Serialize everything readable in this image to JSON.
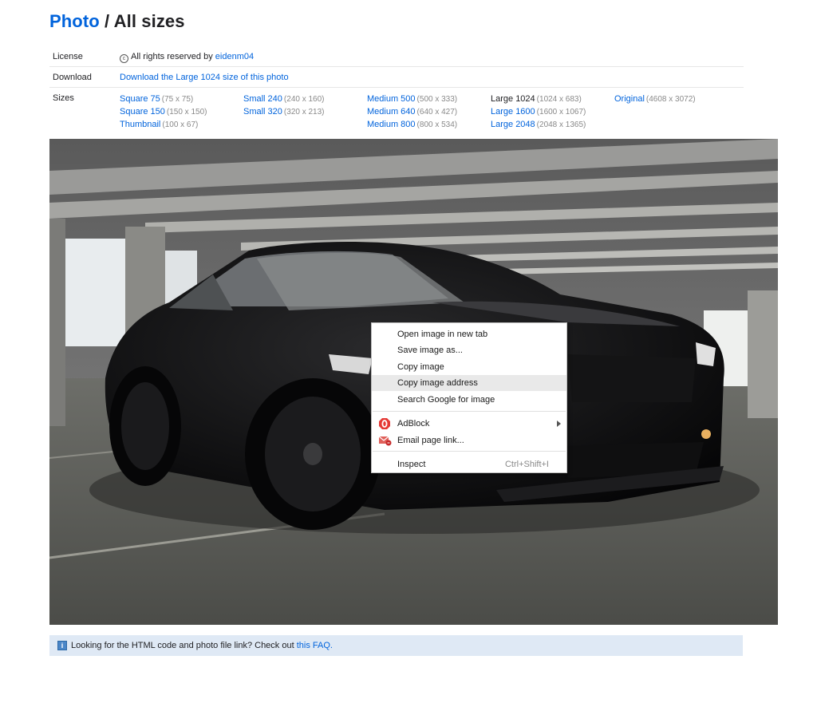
{
  "header": {
    "photo_link": "Photo",
    "separator": " / ",
    "title": "All sizes"
  },
  "meta": {
    "license_label": "License",
    "license_text": "All rights reserved by",
    "license_user": "eidenm04",
    "download_label": "Download",
    "download_link": "Download the Large 1024 size of this photo",
    "sizes_label": "Sizes"
  },
  "sizes": [
    [
      {
        "name": "Square 75",
        "dim": "(75 x 75)"
      },
      {
        "name": "Square 150",
        "dim": "(150 x 150)"
      },
      {
        "name": "Thumbnail",
        "dim": "(100 x 67)"
      }
    ],
    [
      {
        "name": "Small 240",
        "dim": "(240 x 160)"
      },
      {
        "name": "Small 320",
        "dim": "(320 x 213)"
      }
    ],
    [
      {
        "name": "Medium 500",
        "dim": "(500 x 333)"
      },
      {
        "name": "Medium 640",
        "dim": "(640 x 427)"
      },
      {
        "name": "Medium 800",
        "dim": "(800 x 534)"
      }
    ],
    [
      {
        "name": "Large 1024",
        "dim": "(1024 x 683)",
        "current": true
      },
      {
        "name": "Large 1600",
        "dim": "(1600 x 1067)"
      },
      {
        "name": "Large 2048",
        "dim": "(2048 x 1365)"
      }
    ],
    [
      {
        "name": "Original",
        "dim": "(4608 x 3072)"
      }
    ]
  ],
  "context_menu": {
    "items": [
      {
        "label": "Open image in new tab"
      },
      {
        "label": "Save image as..."
      },
      {
        "label": "Copy image"
      },
      {
        "label": "Copy image address",
        "highlighted": true
      },
      {
        "label": "Search Google for image"
      },
      {
        "label": "AdBlock",
        "icon": "adblock-icon",
        "submenu": true
      },
      {
        "label": "Email page link...",
        "icon": "email-icon"
      },
      {
        "label": "Inspect",
        "shortcut": "Ctrl+Shift+I"
      }
    ]
  },
  "faq": {
    "text": "Looking for the HTML code and photo file link? Check out",
    "link": "this FAQ."
  },
  "colors": {
    "link": "#0063dc",
    "faq_background": "#dfe9f5",
    "menu_highlight": "#e9e9e9"
  }
}
